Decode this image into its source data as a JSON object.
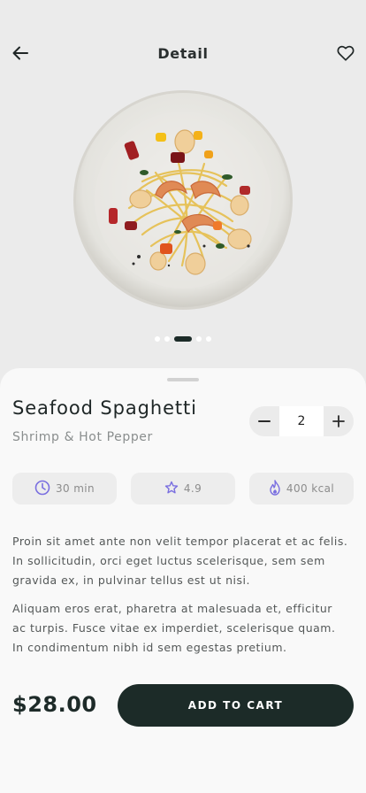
{
  "header": {
    "title": "Detail"
  },
  "carousel": {
    "count": 5,
    "active_index": 2
  },
  "product": {
    "name": "Seafood Spaghetti",
    "subtitle": "Shrimp & Hot Pepper",
    "quantity": "2",
    "stats": {
      "time": "30 min",
      "rating": "4.9",
      "calories": "400 kcal"
    },
    "description": [
      "Proin sit amet ante non velit tempor placerat et ac felis. In sollicitudin, orci eget luctus scelerisque, sem sem gravida ex, in pulvinar tellus est ut nisi.",
      "Aliquam eros erat, pharetra at malesuada et, efficitur ac turpis. Fusce vitae ex imperdiet, scelerisque quam. In condimentum nibh id sem egestas pretium."
    ],
    "price": "$28.00"
  },
  "actions": {
    "add_to_cart": "ADD TO CART"
  },
  "colors": {
    "accent_dark": "#1c2b28",
    "icon_purple": "#7a6fe0",
    "background": "#ebebeb",
    "sheet": "#f9f9f9"
  }
}
